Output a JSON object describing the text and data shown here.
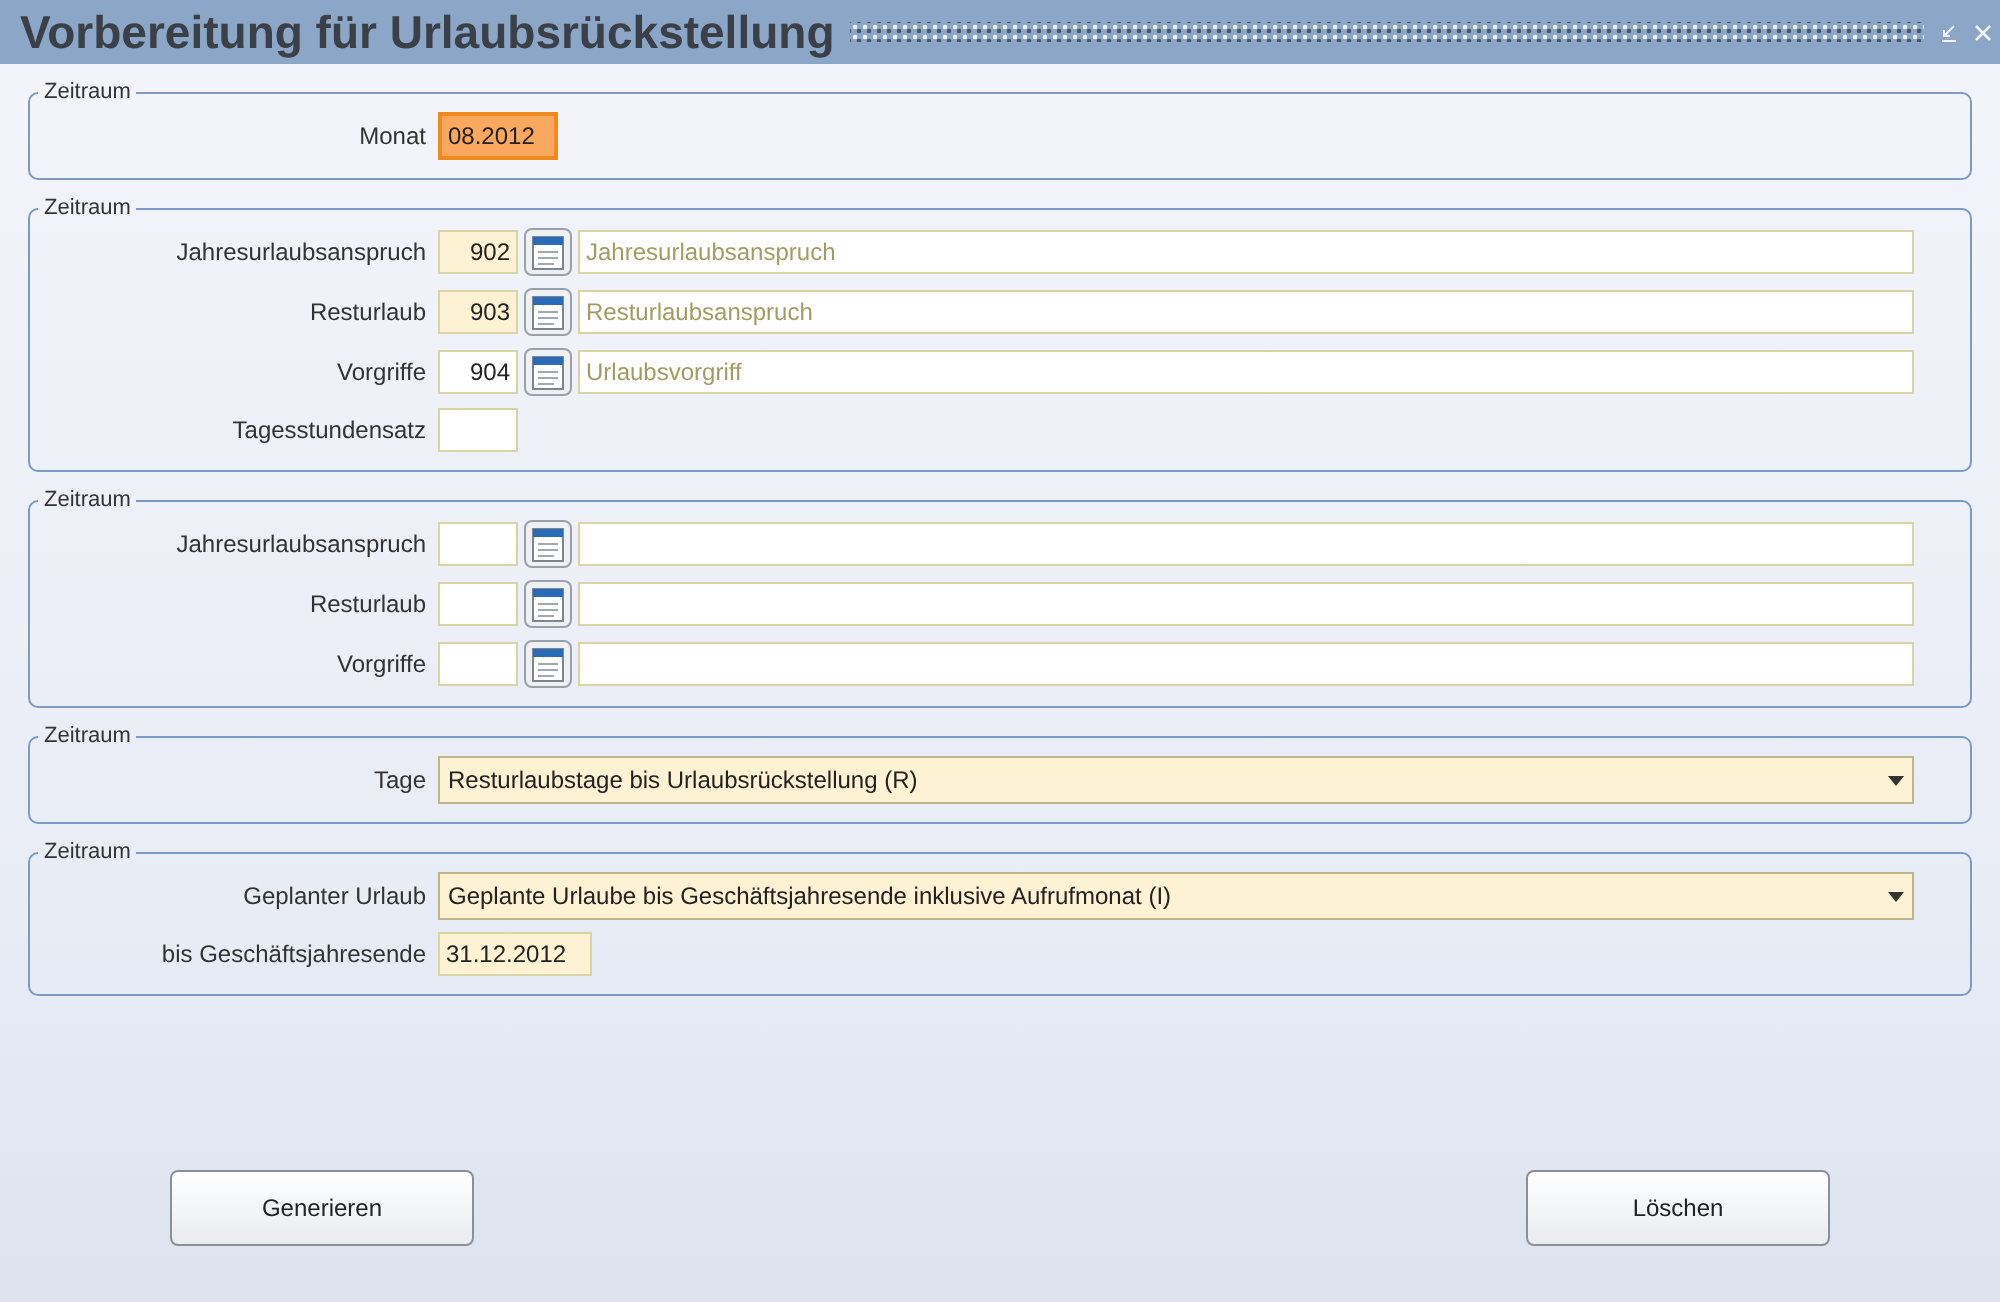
{
  "window": {
    "title": "Vorbereitung für Urlaubsrückstellung"
  },
  "sections": [
    {
      "legend": "Zeitraum",
      "rows": [
        {
          "kind": "month",
          "label": "Monat",
          "value": "08.2012",
          "focused": true
        }
      ]
    },
    {
      "legend": "Zeitraum",
      "rows": [
        {
          "kind": "lookup",
          "label": "Jahresurlaubsanspruch",
          "code": "902",
          "description": "Jahresurlaubsanspruch",
          "required": true
        },
        {
          "kind": "lookup",
          "label": "Resturlaub",
          "code": "903",
          "description": "Resturlaubsanspruch",
          "required": true
        },
        {
          "kind": "lookup",
          "label": "Vorgriffe",
          "code": "904",
          "description": "Urlaubsvorgriff",
          "required": false
        },
        {
          "kind": "text",
          "label": "Tagesstundensatz",
          "required": false
        }
      ]
    },
    {
      "legend": "Zeitraum",
      "rows": [
        {
          "kind": "lookup",
          "label": "Jahresurlaubsanspruch",
          "required": false
        },
        {
          "kind": "lookup",
          "label": "Resturlaub",
          "required": false
        },
        {
          "kind": "lookup",
          "label": "Vorgriffe",
          "required": false
        }
      ]
    },
    {
      "legend": "Zeitraum",
      "rows": [
        {
          "kind": "select",
          "label": "Tage",
          "value": "Resturlaubstage bis Urlaubsrückstellung (R)"
        }
      ]
    },
    {
      "legend": "Zeitraum",
      "rows": [
        {
          "kind": "select",
          "label": "Geplanter Urlaub",
          "value": "Geplante Urlaube bis Geschäftsjahresende inklusive Aufrufmonat (I)"
        },
        {
          "kind": "date",
          "label": "bis Geschäftsjahresende",
          "value": "31.12.2012",
          "required": true
        }
      ]
    }
  ],
  "buttons": [
    "Generieren",
    "Löschen"
  ]
}
